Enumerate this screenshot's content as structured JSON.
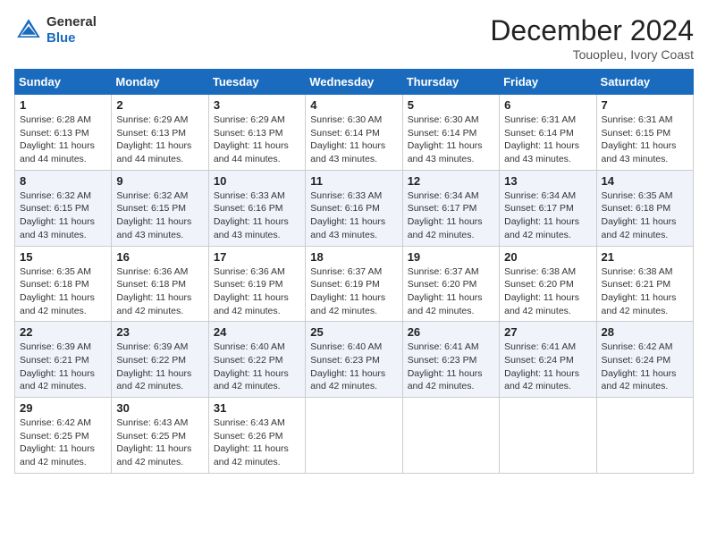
{
  "header": {
    "logo_general": "General",
    "logo_blue": "Blue",
    "month_title": "December 2024",
    "subtitle": "Touopleu, Ivory Coast"
  },
  "days_of_week": [
    "Sunday",
    "Monday",
    "Tuesday",
    "Wednesday",
    "Thursday",
    "Friday",
    "Saturday"
  ],
  "weeks": [
    [
      {
        "day": "1",
        "sunrise": "6:28 AM",
        "sunset": "6:13 PM",
        "daylight": "11 hours and 44 minutes."
      },
      {
        "day": "2",
        "sunrise": "6:29 AM",
        "sunset": "6:13 PM",
        "daylight": "11 hours and 44 minutes."
      },
      {
        "day": "3",
        "sunrise": "6:29 AM",
        "sunset": "6:13 PM",
        "daylight": "11 hours and 44 minutes."
      },
      {
        "day": "4",
        "sunrise": "6:30 AM",
        "sunset": "6:14 PM",
        "daylight": "11 hours and 43 minutes."
      },
      {
        "day": "5",
        "sunrise": "6:30 AM",
        "sunset": "6:14 PM",
        "daylight": "11 hours and 43 minutes."
      },
      {
        "day": "6",
        "sunrise": "6:31 AM",
        "sunset": "6:14 PM",
        "daylight": "11 hours and 43 minutes."
      },
      {
        "day": "7",
        "sunrise": "6:31 AM",
        "sunset": "6:15 PM",
        "daylight": "11 hours and 43 minutes."
      }
    ],
    [
      {
        "day": "8",
        "sunrise": "6:32 AM",
        "sunset": "6:15 PM",
        "daylight": "11 hours and 43 minutes."
      },
      {
        "day": "9",
        "sunrise": "6:32 AM",
        "sunset": "6:15 PM",
        "daylight": "11 hours and 43 minutes."
      },
      {
        "day": "10",
        "sunrise": "6:33 AM",
        "sunset": "6:16 PM",
        "daylight": "11 hours and 43 minutes."
      },
      {
        "day": "11",
        "sunrise": "6:33 AM",
        "sunset": "6:16 PM",
        "daylight": "11 hours and 43 minutes."
      },
      {
        "day": "12",
        "sunrise": "6:34 AM",
        "sunset": "6:17 PM",
        "daylight": "11 hours and 42 minutes."
      },
      {
        "day": "13",
        "sunrise": "6:34 AM",
        "sunset": "6:17 PM",
        "daylight": "11 hours and 42 minutes."
      },
      {
        "day": "14",
        "sunrise": "6:35 AM",
        "sunset": "6:18 PM",
        "daylight": "11 hours and 42 minutes."
      }
    ],
    [
      {
        "day": "15",
        "sunrise": "6:35 AM",
        "sunset": "6:18 PM",
        "daylight": "11 hours and 42 minutes."
      },
      {
        "day": "16",
        "sunrise": "6:36 AM",
        "sunset": "6:18 PM",
        "daylight": "11 hours and 42 minutes."
      },
      {
        "day": "17",
        "sunrise": "6:36 AM",
        "sunset": "6:19 PM",
        "daylight": "11 hours and 42 minutes."
      },
      {
        "day": "18",
        "sunrise": "6:37 AM",
        "sunset": "6:19 PM",
        "daylight": "11 hours and 42 minutes."
      },
      {
        "day": "19",
        "sunrise": "6:37 AM",
        "sunset": "6:20 PM",
        "daylight": "11 hours and 42 minutes."
      },
      {
        "day": "20",
        "sunrise": "6:38 AM",
        "sunset": "6:20 PM",
        "daylight": "11 hours and 42 minutes."
      },
      {
        "day": "21",
        "sunrise": "6:38 AM",
        "sunset": "6:21 PM",
        "daylight": "11 hours and 42 minutes."
      }
    ],
    [
      {
        "day": "22",
        "sunrise": "6:39 AM",
        "sunset": "6:21 PM",
        "daylight": "11 hours and 42 minutes."
      },
      {
        "day": "23",
        "sunrise": "6:39 AM",
        "sunset": "6:22 PM",
        "daylight": "11 hours and 42 minutes."
      },
      {
        "day": "24",
        "sunrise": "6:40 AM",
        "sunset": "6:22 PM",
        "daylight": "11 hours and 42 minutes."
      },
      {
        "day": "25",
        "sunrise": "6:40 AM",
        "sunset": "6:23 PM",
        "daylight": "11 hours and 42 minutes."
      },
      {
        "day": "26",
        "sunrise": "6:41 AM",
        "sunset": "6:23 PM",
        "daylight": "11 hours and 42 minutes."
      },
      {
        "day": "27",
        "sunrise": "6:41 AM",
        "sunset": "6:24 PM",
        "daylight": "11 hours and 42 minutes."
      },
      {
        "day": "28",
        "sunrise": "6:42 AM",
        "sunset": "6:24 PM",
        "daylight": "11 hours and 42 minutes."
      }
    ],
    [
      {
        "day": "29",
        "sunrise": "6:42 AM",
        "sunset": "6:25 PM",
        "daylight": "11 hours and 42 minutes."
      },
      {
        "day": "30",
        "sunrise": "6:43 AM",
        "sunset": "6:25 PM",
        "daylight": "11 hours and 42 minutes."
      },
      {
        "day": "31",
        "sunrise": "6:43 AM",
        "sunset": "6:26 PM",
        "daylight": "11 hours and 42 minutes."
      },
      null,
      null,
      null,
      null
    ]
  ],
  "labels": {
    "sunrise": "Sunrise:",
    "sunset": "Sunset:",
    "daylight": "Daylight:"
  }
}
